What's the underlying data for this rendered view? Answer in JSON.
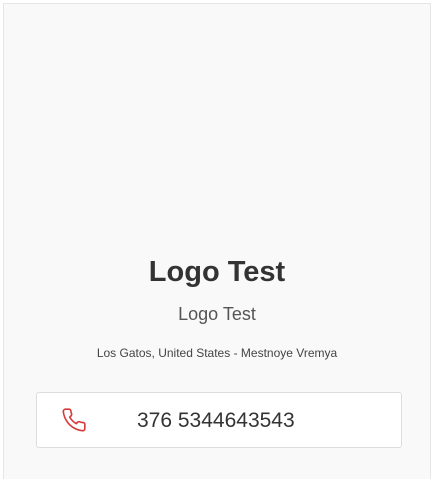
{
  "profile": {
    "name": "Logo Test",
    "subtitle": "Logo Test",
    "location": "Los Gatos, United States - Mestnoye Vremya"
  },
  "contact": {
    "phone_icon": "phone-icon",
    "phone_number": "376 5344643543",
    "accent_color": "#d63b3b"
  }
}
